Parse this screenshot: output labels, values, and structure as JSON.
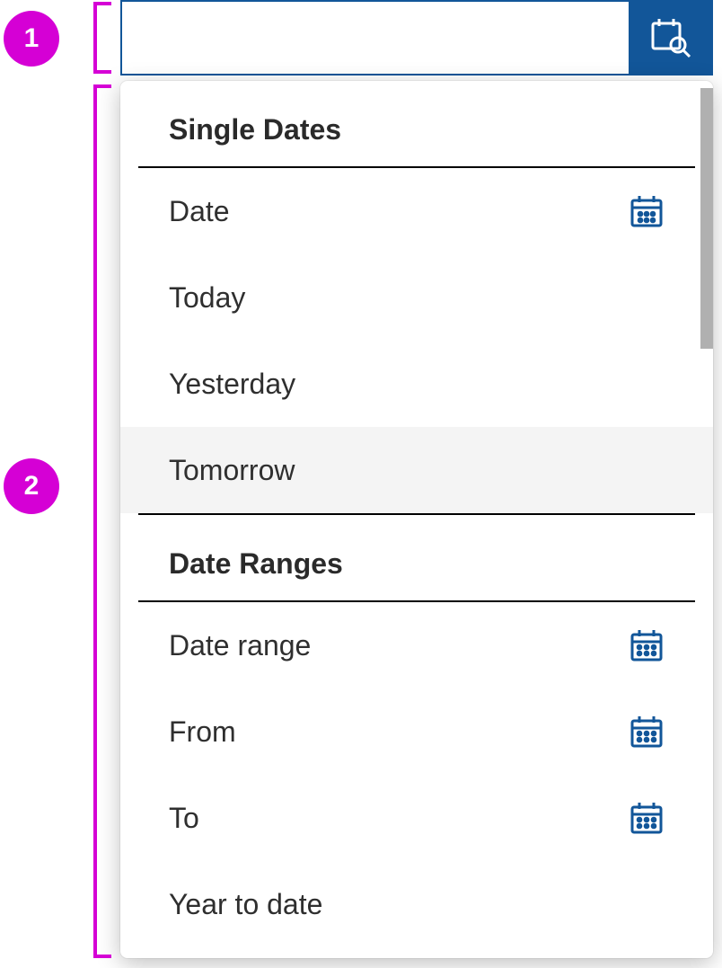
{
  "annotations": {
    "badge1": "1",
    "badge2": "2"
  },
  "input": {
    "value": "",
    "placeholder": ""
  },
  "sections": {
    "single": {
      "header": "Single Dates",
      "items": {
        "date": {
          "label": "Date",
          "icon": "calendar-single"
        },
        "today": {
          "label": "Today"
        },
        "yesterday": {
          "label": "Yesterday"
        },
        "tomorrow": {
          "label": "Tomorrow"
        }
      }
    },
    "ranges": {
      "header": "Date Ranges",
      "items": {
        "date_range": {
          "label": "Date range",
          "icon": "calendar-range"
        },
        "from": {
          "label": "From",
          "icon": "calendar-range"
        },
        "to": {
          "label": "To",
          "icon": "calendar-range"
        },
        "year_to_date": {
          "label": "Year to date"
        }
      }
    }
  },
  "colors": {
    "accent": "#125699",
    "annotation": "#d500d5"
  }
}
